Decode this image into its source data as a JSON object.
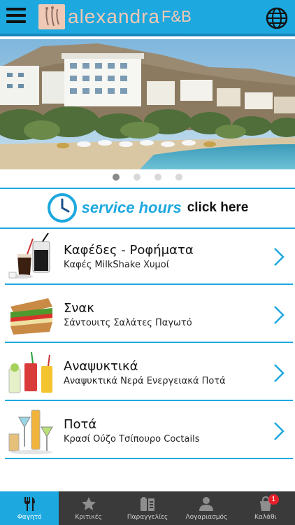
{
  "header": {
    "logo_text": "alexandra",
    "logo_suffix": "F&B",
    "colors": {
      "bar": "#1da8df",
      "logo": "#f3c8b4"
    }
  },
  "hero": {
    "image": "seaside-village-beach-photo",
    "slides": 4,
    "active_slide": 1
  },
  "service": {
    "highlight": "service hours",
    "action": "click here"
  },
  "menu": [
    {
      "title": "Καφέδες - Ροφήματα",
      "subtitle": "Καφές MilkShake Χυμοί",
      "icon": "coffee-drinks-icon"
    },
    {
      "title": "Σνακ",
      "subtitle": "Σάντουιτς Σαλάτες Παγωτό",
      "icon": "sandwich-icon"
    },
    {
      "title": "Αναψυκτικά",
      "subtitle": "Αναψυκτικά Νερά Ενεργειακά Ποτά",
      "icon": "soft-drinks-icon"
    },
    {
      "title": "Ποτά",
      "subtitle": "Κρασί Ούζο Τσίπουρο Coctails",
      "icon": "cocktails-icon"
    }
  ],
  "nav": [
    {
      "label": "Φαγητό",
      "icon": "fork-knife-icon",
      "active": true
    },
    {
      "label": "Κριτικές",
      "icon": "star-icon",
      "active": false
    },
    {
      "label": "Παραγγελίες",
      "icon": "orders-icon",
      "active": false
    },
    {
      "label": "Λογαριασμός",
      "icon": "user-icon",
      "active": false
    },
    {
      "label": "Καλάθι",
      "icon": "cart-icon",
      "active": false,
      "badge": "1"
    }
  ]
}
